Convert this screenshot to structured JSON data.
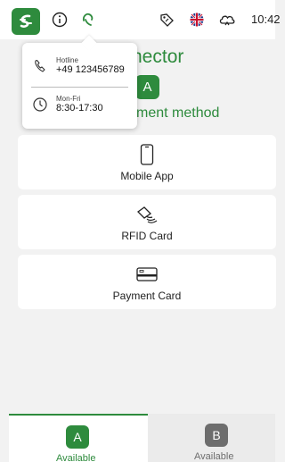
{
  "status_bar": {
    "time": "10:42",
    "icons": [
      "brand-logo-icon",
      "info-icon",
      "hotline-icon",
      "tag-icon",
      "uk-flag-icon",
      "cloud-icon"
    ]
  },
  "header": {
    "title_partial": "nector",
    "connector_letter": "A",
    "subtitle_partial": "yment method"
  },
  "hotline_popup": {
    "hotline_label": "Hotline",
    "hotline_number": "+49 123456789",
    "hours_label": "Mon-Fri",
    "hours_value": "8:30-17:30"
  },
  "payment_methods": [
    {
      "label": "Mobile App",
      "icon": "phone-icon"
    },
    {
      "label": "RFID Card",
      "icon": "rfid-icon"
    },
    {
      "label": "Payment Card",
      "icon": "credit-card-icon"
    }
  ],
  "connectors": [
    {
      "letter": "A",
      "status": "Available",
      "selected": true
    },
    {
      "letter": "B",
      "status": "Available",
      "selected": false
    }
  ],
  "colors": {
    "accent": "#2e8b3d",
    "inactive_badge": "#6d6d6d",
    "background": "#f2f2f2"
  }
}
